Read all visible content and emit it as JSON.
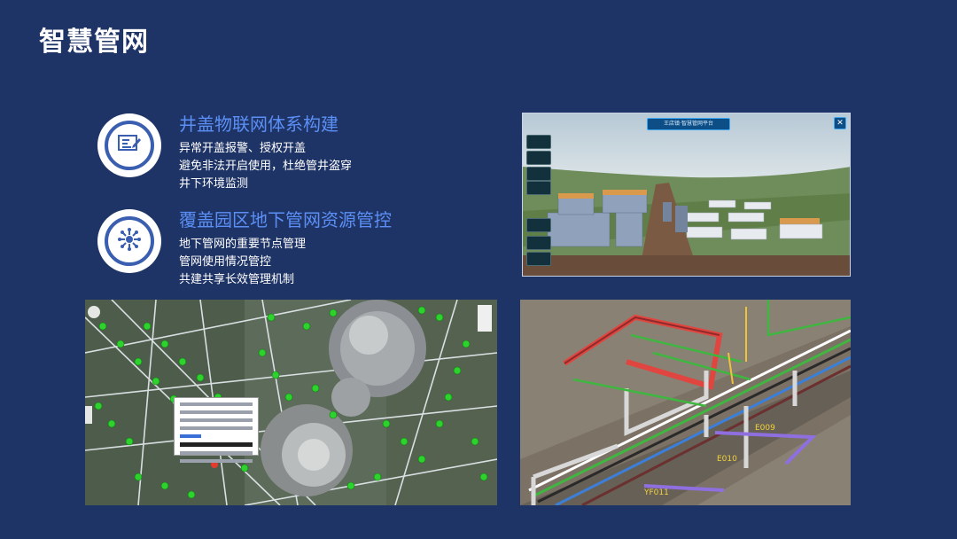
{
  "page": {
    "title": "智慧管网",
    "background": "#1f3466",
    "accent": "#5b8ff5"
  },
  "features": [
    {
      "icon": "form-edit-icon",
      "heading": "井盖物联网体系构建",
      "lines": [
        "异常开盖报警、授权开盖",
        "避免非法开启使用，杜绝管井盗穿",
        "井下环境监测"
      ]
    },
    {
      "icon": "network-hub-icon",
      "heading": "覆盖园区地下管网资源管控",
      "lines": [
        "地下管网的重要节点管理",
        "管网使用情况管控",
        "共建共享长效管理机制"
      ]
    }
  ],
  "screenshots": {
    "city_3d": {
      "banner": "王店镇·智慧管网平台",
      "close": "✕"
    },
    "pipe_3d": {
      "labels": [
        "E009",
        "E010",
        "YF011"
      ]
    }
  }
}
